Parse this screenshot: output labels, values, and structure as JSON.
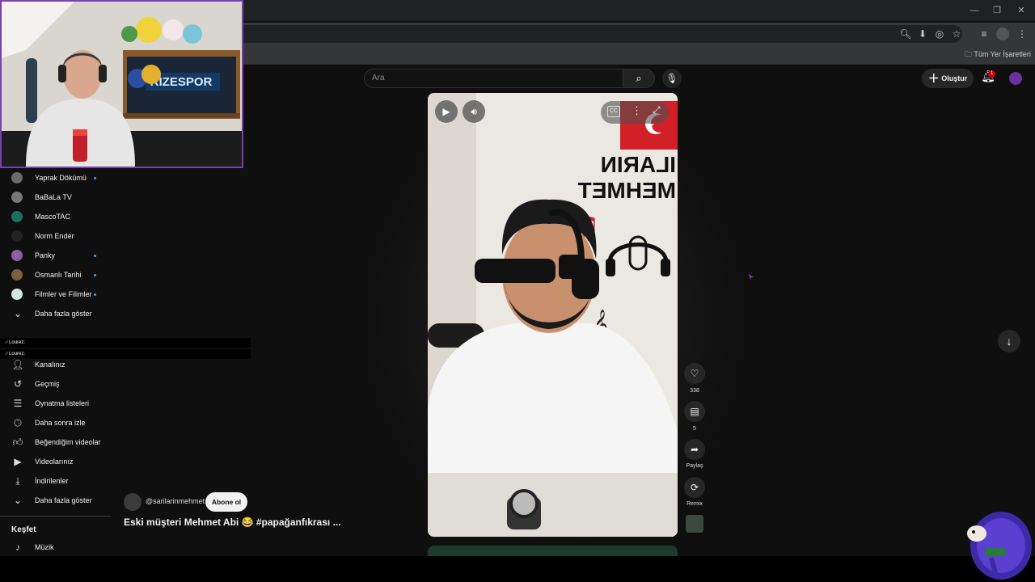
{
  "browser": {
    "bookmarks_folder": "Tüm Yer İşaretleri"
  },
  "youtube": {
    "search": {
      "placeholder": "Ara"
    },
    "create_label": "Oluştur",
    "notif_count": "1"
  },
  "sidebar": {
    "subscriptions": [
      {
        "label": "Yaprak Dökümü",
        "color": "#6b6b6b",
        "live": true
      },
      {
        "label": "BaBaLa TV",
        "color": "#777777",
        "live": false
      },
      {
        "label": "MascoTAC",
        "color": "#1d6f5c",
        "live": false
      },
      {
        "label": "Norm Ender",
        "color": "#222222",
        "live": false
      },
      {
        "label": "Panky",
        "color": "#8a5fa3",
        "live": true
      },
      {
        "label": "Osmanlı Tarihi",
        "color": "#7a5f3a",
        "live": true
      },
      {
        "label": "Filmler ve Filimler",
        "color": "#cfe8e2",
        "live": true
      }
    ],
    "show_more_1": "Daha fazla göster",
    "chat": [
      {
        "user": "Lourez:",
        "text": ""
      },
      {
        "user": "Lourez:",
        "text": ""
      }
    ],
    "you_items": [
      {
        "label": "Kanalınız",
        "icon": "person-icon"
      },
      {
        "label": "Geçmiş",
        "icon": "history-icon"
      },
      {
        "label": "Oynatma listeleri",
        "icon": "playlist-icon"
      },
      {
        "label": "Daha sonra izle",
        "icon": "clock-icon"
      },
      {
        "label": "Beğendiğim videolar",
        "icon": "thumbs-up-icon"
      },
      {
        "label": "Videolarınız",
        "icon": "video-icon"
      },
      {
        "label": "İndirilenler",
        "icon": "download-icon"
      }
    ],
    "show_more_2": "Daha fazla göster",
    "explore_heading": "Keşfet",
    "music": "Müzik"
  },
  "short": {
    "channel": "@sarilarinmehmet",
    "subscribe": "Abone ol",
    "title": "Eski müşteri Mehmet Abi 😂 #papağanfıkrası ...",
    "likes": "338",
    "comments": "5",
    "share": "Paylaş",
    "remix": "Remix",
    "wall_text_1": "ILARIN",
    "wall_text_2": "MEHMET"
  },
  "webcam": {
    "shelf_text": "RIZESPOR"
  }
}
